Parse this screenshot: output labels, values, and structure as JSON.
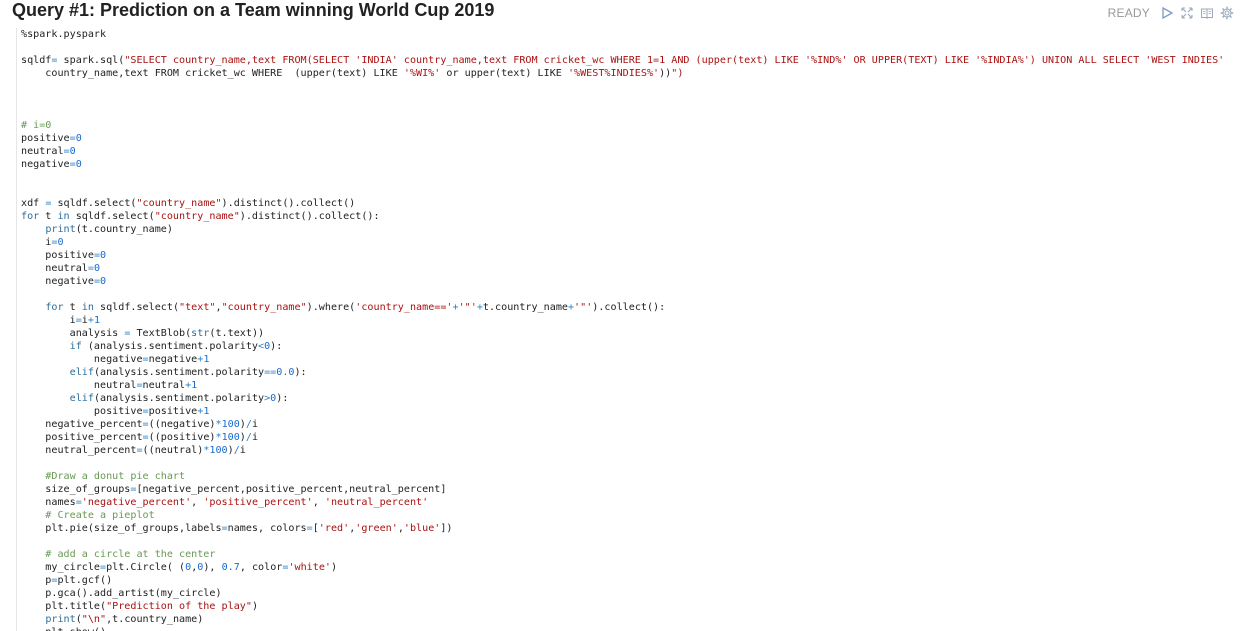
{
  "paragraph": {
    "title": "Query #1: Prediction on a Team winning World Cup 2019",
    "status": "READY",
    "controls": [
      "run-icon",
      "expand-icon",
      "book-icon",
      "gear-icon"
    ],
    "code_lines": [
      "%spark.pyspark",
      "",
      "sqldf= spark.sql(\"SELECT country_name,text FROM(SELECT 'INDIA' country_name,text FROM cricket_wc WHERE 1=1 AND (upper(text) LIKE '%IND%' OR UPPER(TEXT) LIKE '%INDIA%') UNION ALL SELECT 'WEST INDIES'",
      "    country_name,text FROM cricket_wc WHERE  (upper(text) LIKE '%WI%' or upper(text) LIKE '%WEST%INDIES%'))\")",
      "",
      "",
      "",
      "# i=0",
      "positive=0",
      "neutral=0",
      "negative=0",
      "",
      "",
      "xdf = sqldf.select(\"country_name\").distinct().collect()",
      "for t in sqldf.select(\"country_name\").distinct().collect():",
      "    print(t.country_name)",
      "    i=0",
      "    positive=0",
      "    neutral=0",
      "    negative=0",
      "",
      "    for t in sqldf.select(\"text\",\"country_name\").where('country_name=='+'\"'+t.country_name+'\"').collect():",
      "        i=i+1",
      "        analysis = TextBlob(str(t.text))",
      "        if (analysis.sentiment.polarity<0):",
      "            negative=negative+1",
      "        elif(analysis.sentiment.polarity==0.0):",
      "            neutral=neutral+1",
      "        elif(analysis.sentiment.polarity>0):",
      "            positive=positive+1",
      "    negative_percent=((negative)*100)/i",
      "    positive_percent=((positive)*100)/i",
      "    neutral_percent=((neutral)*100)/i",
      "",
      "    #Draw a donut pie chart",
      "    size_of_groups=[negative_percent,positive_percent,neutral_percent]",
      "    names='negative_percent', 'positive_percent', 'neutral_percent'",
      "    # Create a pieplot",
      "    plt.pie(size_of_groups,labels=names, colors=['red','green','blue'])",
      "",
      "    # add a circle at the center",
      "    my_circle=plt.Circle( (0,0), 0.7, color='white')",
      "    p=plt.gcf()",
      "    p.gca().add_artist(my_circle)",
      "    plt.title(\"Prediction of the play\")",
      "    print(\"\\n\",t.country_name)",
      "    plt.show()"
    ]
  },
  "colors": {
    "keyword": "#2c6e9e",
    "string": "#aa1111",
    "number": "#1a6bd0",
    "comment": "#6a9955",
    "status": "#999999",
    "icon": "#9aa9bd"
  }
}
